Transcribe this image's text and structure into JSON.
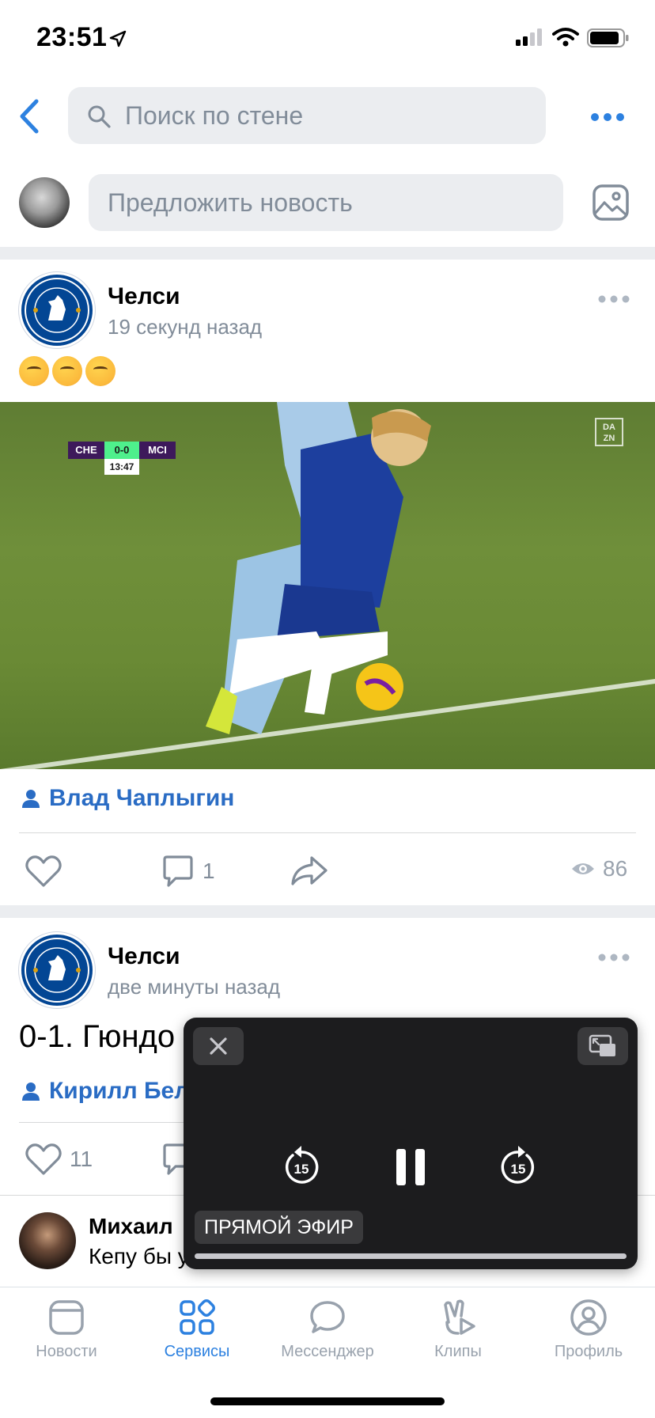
{
  "status_bar": {
    "time": "23:51"
  },
  "header": {
    "search_placeholder": "Поиск по стене"
  },
  "suggest": {
    "placeholder": "Предложить новость"
  },
  "posts": [
    {
      "author": "Челси",
      "time": "19 секунд назад",
      "text": "🤔🤔🤔",
      "video": {
        "score_home": "CHE",
        "score": "0-0",
        "score_away": "MCI",
        "clock": "13:47",
        "watermark": "DAZN"
      },
      "mention": "Влад Чаплыгин",
      "comments": "1",
      "views": "86"
    },
    {
      "author": "Челси",
      "time": "две минуты назад",
      "text": "0-1. Гюндо",
      "mention": "Кирилл Бел",
      "likes": "11"
    }
  ],
  "comment": {
    "author": "Михаил",
    "text": "Кепу бы у"
  },
  "pip": {
    "live_label": "ПРЯМОЙ ЭФИР",
    "skip_seconds": "15"
  },
  "tabs": [
    {
      "label": "Новости",
      "icon": "news-icon",
      "active": false
    },
    {
      "label": "Сервисы",
      "icon": "services-icon",
      "active": true
    },
    {
      "label": "Мессенджер",
      "icon": "messenger-icon",
      "active": false
    },
    {
      "label": "Клипы",
      "icon": "clips-icon",
      "active": false
    },
    {
      "label": "Профиль",
      "icon": "profile-icon",
      "active": false
    }
  ],
  "colors": {
    "accent": "#2d81e0",
    "link": "#2a6cc4",
    "secondary": "#818c99",
    "pip_bg": "#1c1c1e"
  }
}
